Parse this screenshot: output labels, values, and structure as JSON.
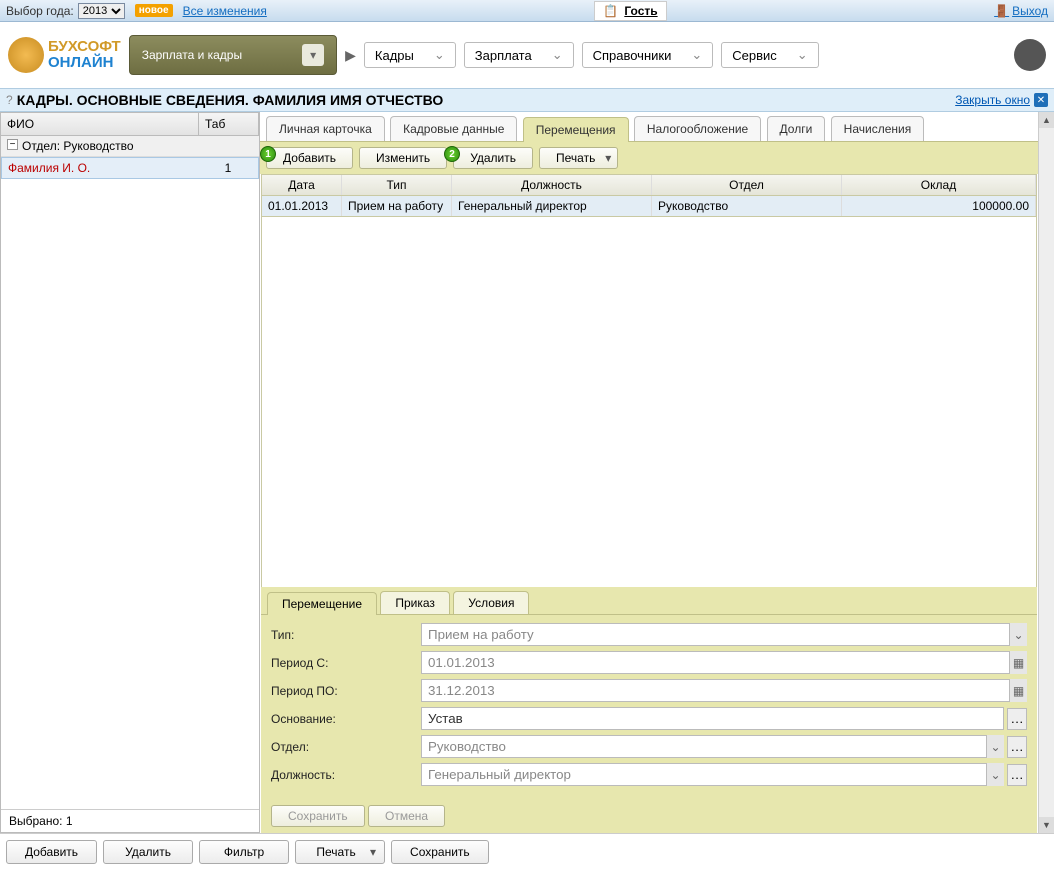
{
  "topbar": {
    "year_label": "Выбор года:",
    "year_value": "2013",
    "new_badge": "новое",
    "all_changes": "Все изменения",
    "guest": "Гость",
    "exit": "Выход"
  },
  "header": {
    "logo_line1": "БУХСОФТ",
    "logo_line2": "ОНЛАЙН",
    "module": "Зарплата и кадры",
    "menus": [
      "Кадры",
      "Зарплата",
      "Справочники",
      "Сервис"
    ]
  },
  "title": {
    "text": "КАДРЫ. ОСНОВНЫЕ СВЕДЕНИЯ. ФАМИЛИЯ ИМЯ ОТЧЕСТВО",
    "close": "Закрыть окно"
  },
  "left": {
    "col_fio": "ФИО",
    "col_tab": "Таб",
    "dept": "Отдел: Руководство",
    "emp_name": "Фамилия И. О.",
    "emp_tab": "1",
    "selected": "Выбрано: 1"
  },
  "tabs": [
    "Личная карточка",
    "Кадровые данные",
    "Перемещения",
    "Налогообложение",
    "Долги",
    "Начисления"
  ],
  "toolbar": {
    "add": "Добавить",
    "edit": "Изменить",
    "delete": "Удалить",
    "print": "Печать"
  },
  "grid": {
    "headers": {
      "date": "Дата",
      "type": "Тип",
      "position": "Должность",
      "dept": "Отдел",
      "salary": "Оклад"
    },
    "rows": [
      {
        "date": "01.01.2013",
        "type": "Прием на работу",
        "position": "Генеральный директор",
        "dept": "Руководство",
        "salary": "100000.00"
      }
    ]
  },
  "subtabs": [
    "Перемещение",
    "Приказ",
    "Условия"
  ],
  "form": {
    "l_type": "Тип:",
    "v_type": "Прием на работу",
    "l_from": "Период С:",
    "v_from": "01.01.2013",
    "l_to": "Период ПО:",
    "v_to": "31.12.2013",
    "l_basis": "Основание:",
    "v_basis": "Устав",
    "l_dept": "Отдел:",
    "v_dept": "Руководство",
    "l_pos": "Должность:",
    "v_pos": "Генеральный директор",
    "save": "Сохранить",
    "cancel": "Отмена"
  },
  "bottom": {
    "add": "Добавить",
    "delete": "Удалить",
    "filter": "Фильтр",
    "print": "Печать",
    "save": "Сохранить"
  }
}
